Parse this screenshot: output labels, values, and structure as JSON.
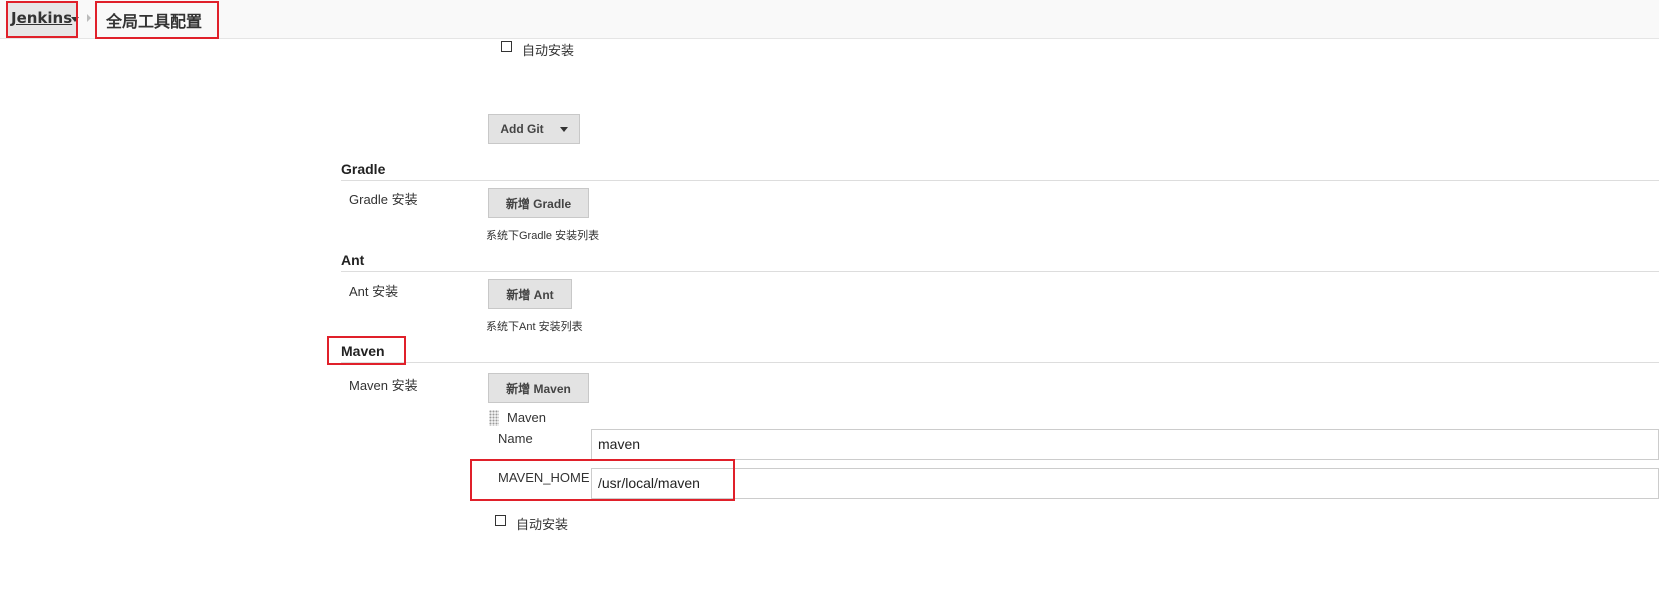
{
  "breadcrumb": {
    "root": "Jenkins",
    "current": "全局工具配置"
  },
  "git_section": {
    "auto_install_label": "自动安装",
    "add_button": "Add Git"
  },
  "gradle": {
    "title": "Gradle",
    "row_label": "Gradle 安装",
    "add_button": "新增 Gradle",
    "help": "系统下Gradle 安装列表"
  },
  "ant": {
    "title": "Ant",
    "row_label": "Ant 安装",
    "add_button": "新增 Ant",
    "help": "系统下Ant 安装列表"
  },
  "maven": {
    "title": "Maven",
    "row_label": "Maven 安装",
    "add_button": "新增 Maven",
    "installation_header": "Maven",
    "name_label": "Name",
    "name_value": "maven",
    "home_label": "MAVEN_HOME",
    "home_value": "/usr/local/maven",
    "auto_install_label": "自动安装"
  },
  "colors": {
    "highlight": "#e0202a",
    "button_bg": "#e3e3e3",
    "rule": "#dddddd"
  }
}
